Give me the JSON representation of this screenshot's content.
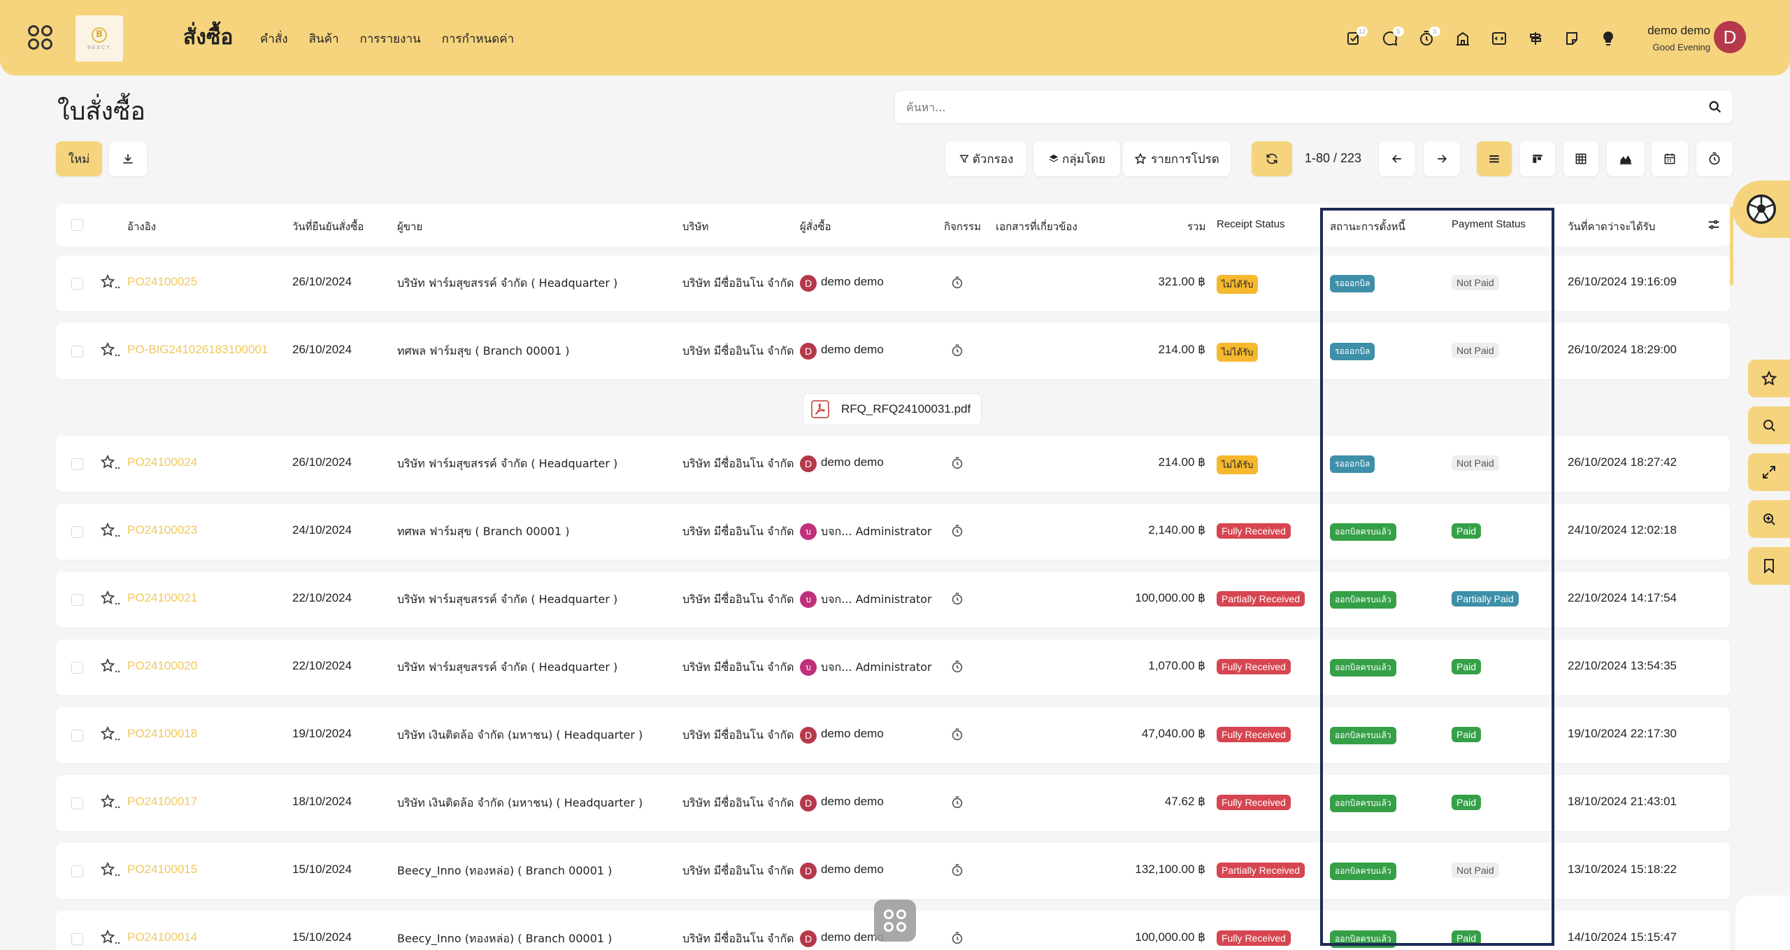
{
  "header": {
    "app_title": "สั่งซื้อ",
    "logo_text": "BEECY",
    "menu": [
      "คำสั่ง",
      "สินค้า",
      "การรายงาน",
      "การกำหนดค่า"
    ],
    "badges": {
      "activity": "12",
      "messages": "5",
      "timer": "3"
    },
    "user_name": "demo demo",
    "greeting": "Good Evening",
    "avatar_letter": "D"
  },
  "control": {
    "page_title": "ใบสั่งซื้อ",
    "search_placeholder": "ค้นหา...",
    "new_button": "ใหม่",
    "filter": "ตัวกรอง",
    "group_by": "กลุ่มโดย",
    "favorites": "รายการโปรด",
    "pager": "1-80 / 223"
  },
  "columns": {
    "ref": "อ้างอิง",
    "confirm_date": "วันที่ยืนยันสั่งซื้อ",
    "vendor": "ผู้ขาย",
    "company": "บริษัท",
    "buyer": "ผู้สั่งซื้อ",
    "activity": "กิจกรรม",
    "source_doc": "เอกสารที่เกี่ยวข้อง",
    "total": "รวม",
    "receipt_status": "Receipt Status",
    "billing_status": "สถานะการตั้งหนี้",
    "payment_status": "Payment Status",
    "expected_date": "วันที่คาดว่าจะได้รับ"
  },
  "attachment": {
    "filename": "RFQ_RFQ24100031.pdf"
  },
  "rows": [
    {
      "ref": "PO24100025",
      "date": "26/10/2024",
      "vendor": "บริษัท ฟาร์มสุขสรรค์ จำกัด ( Headquarter )",
      "company": "บริษัท มีซื่ออินโน จำกัด",
      "buyer_initial": "D",
      "buyer": "demo demo",
      "total": "321.00 ฿",
      "receipt": "ไม่ได้รับ",
      "receipt_style": "warn",
      "billing": "รอออกบิล",
      "billing_style": "teal",
      "payment": "Not Paid",
      "payment_style": "grey",
      "expected": "26/10/2024 19:16:09"
    },
    {
      "ref": "PO-BIG241026183100001",
      "date": "26/10/2024",
      "vendor": "ทศพล ฟาร์มสุข ( Branch 00001 )",
      "company": "บริษัท มีซื่ออินโน จำกัด",
      "buyer_initial": "D",
      "buyer": "demo demo",
      "total": "214.00 ฿",
      "receipt": "ไม่ได้รับ",
      "receipt_style": "warn",
      "billing": "รอออกบิล",
      "billing_style": "teal",
      "payment": "Not Paid",
      "payment_style": "grey",
      "expected": "26/10/2024 18:29:00"
    },
    {
      "ref": "PO24100024",
      "date": "26/10/2024",
      "vendor": "บริษัท ฟาร์มสุขสรรค์ จำกัด ( Headquarter )",
      "company": "บริษัท มีซื่ออินโน จำกัด",
      "buyer_initial": "D",
      "buyer": "demo demo",
      "total": "214.00 ฿",
      "receipt": "ไม่ได้รับ",
      "receipt_style": "warn",
      "billing": "รอออกบิล",
      "billing_style": "teal",
      "payment": "Not Paid",
      "payment_style": "grey",
      "expected": "26/10/2024 18:27:42"
    },
    {
      "ref": "PO24100023",
      "date": "24/10/2024",
      "vendor": "ทศพล ฟาร์มสุข ( Branch 00001 )",
      "company": "บริษัท มีซื่ออินโน จำกัด",
      "buyer_initial": "บ",
      "buyer": "บจก... Administrator",
      "total": "2,140.00 ฿",
      "receipt": "Fully Received",
      "receipt_style": "red",
      "billing": "ออกบิลครบแล้ว",
      "billing_style": "green",
      "payment": "Paid",
      "payment_style": "greenen",
      "expected": "24/10/2024 12:02:18"
    },
    {
      "ref": "PO24100021",
      "date": "22/10/2024",
      "vendor": "บริษัท ฟาร์มสุขสรรค์ จำกัด ( Headquarter )",
      "company": "บริษัท มีซื่ออินโน จำกัด",
      "buyer_initial": "บ",
      "buyer": "บจก... Administrator",
      "total": "100,000.00 ฿",
      "receipt": "Partially Received",
      "receipt_style": "red",
      "billing": "ออกบิลครบแล้ว",
      "billing_style": "green",
      "payment": "Partially Paid",
      "payment_style": "tealen",
      "expected": "22/10/2024 14:17:54"
    },
    {
      "ref": "PO24100020",
      "date": "22/10/2024",
      "vendor": "บริษัท ฟาร์มสุขสรรค์ จำกัด ( Headquarter )",
      "company": "บริษัท มีซื่ออินโน จำกัด",
      "buyer_initial": "บ",
      "buyer": "บจก... Administrator",
      "total": "1,070.00 ฿",
      "receipt": "Fully Received",
      "receipt_style": "red",
      "billing": "ออกบิลครบแล้ว",
      "billing_style": "green",
      "payment": "Paid",
      "payment_style": "greenen",
      "expected": "22/10/2024 13:54:35"
    },
    {
      "ref": "PO24100018",
      "date": "19/10/2024",
      "vendor": "บริษัท เงินติดล้อ จำกัด (มหาชน) ( Headquarter )",
      "company": "บริษัท มีซื่ออินโน จำกัด",
      "buyer_initial": "D",
      "buyer": "demo demo",
      "total": "47,040.00 ฿",
      "receipt": "Fully Received",
      "receipt_style": "red",
      "billing": "ออกบิลครบแล้ว",
      "billing_style": "green",
      "payment": "Paid",
      "payment_style": "greenen",
      "expected": "19/10/2024 22:17:30"
    },
    {
      "ref": "PO24100017",
      "date": "18/10/2024",
      "vendor": "บริษัท เงินติดล้อ จำกัด (มหาชน) ( Headquarter )",
      "company": "บริษัท มีซื่ออินโน จำกัด",
      "buyer_initial": "D",
      "buyer": "demo demo",
      "total": "47.62 ฿",
      "receipt": "Fully Received",
      "receipt_style": "red",
      "billing": "ออกบิลครบแล้ว",
      "billing_style": "green",
      "payment": "Paid",
      "payment_style": "greenen",
      "expected": "18/10/2024 21:43:01"
    },
    {
      "ref": "PO24100015",
      "date": "15/10/2024",
      "vendor": "Beecy_Inno (ทองหล่อ) ( Branch 00001 )",
      "company": "บริษัท มีซื่ออินโน จำกัด",
      "buyer_initial": "D",
      "buyer": "demo demo",
      "total": "132,100.00 ฿",
      "receipt": "Partially Received",
      "receipt_style": "red",
      "billing": "ออกบิลครบแล้ว",
      "billing_style": "green",
      "payment": "Not Paid",
      "payment_style": "grey",
      "expected": "13/10/2024 15:18:22"
    },
    {
      "ref": "PO24100014",
      "date": "15/10/2024",
      "vendor": "Beecy_Inno (ทองหล่อ) ( Branch 00001 )",
      "company": "บริษัท มีซื่ออินโน จำกัด",
      "buyer_initial": "D",
      "buyer": "demo demo",
      "total": "100,000.00 ฿",
      "receipt": "Fully Received",
      "receipt_style": "red",
      "billing": "ออกบิลครบแล้ว",
      "billing_style": "green",
      "payment": "Paid",
      "payment_style": "greenen",
      "expected": "14/10/2024 15:15:47"
    }
  ]
}
